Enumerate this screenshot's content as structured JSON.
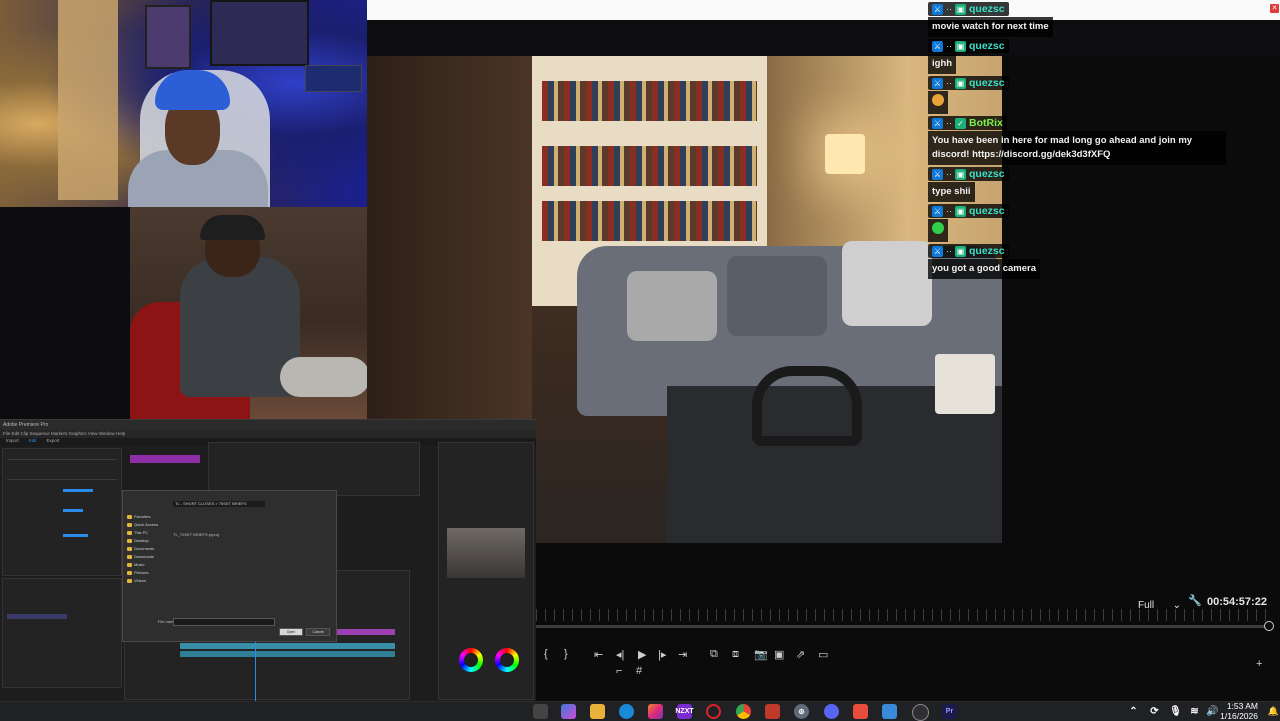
{
  "chat": {
    "messages": [
      {
        "user": "quezsc",
        "color": "#38e0c8",
        "text": "movie watch for next time"
      },
      {
        "user": "quezsc",
        "color": "#38e0c8",
        "text": "ighh"
      },
      {
        "user": "quezsc",
        "color": "#38e0c8",
        "text": "",
        "emote": "emoji-face-icon"
      },
      {
        "user": "BotRix",
        "color": "#7cf04a",
        "text": "You have been in here for mad long go ahead and join my discord! https://discord.gg/dek3d3fXFQ",
        "bot": true
      },
      {
        "user": "quezsc",
        "color": "#38e0c8",
        "text": "type shii"
      },
      {
        "user": "quezsc",
        "color": "#38e0c8",
        "text": "",
        "emote": "green-emote-icon"
      },
      {
        "user": "quezsc",
        "color": "#38e0c8",
        "text": "you got a good camera"
      }
    ]
  },
  "player": {
    "quality": "Full",
    "timecode": "00:54:57:22"
  },
  "taskbar": {
    "time": "1:53 AM",
    "date": "1/16/2026",
    "apps": [
      "explorer-icon",
      "edge-icon",
      "instagram-icon",
      "nzxt-icon",
      "opera-icon",
      "chrome-icon",
      "voicemeeter-icon",
      "settings-icon",
      "discord-icon",
      "app-icon",
      "photos-icon",
      "obs-icon",
      "premiere-icon"
    ],
    "nzxt_label": "NZXT"
  },
  "premiere": {
    "tabs": [
      "Import",
      "Edit",
      "Export"
    ],
    "dialog_path": "TL - SHORT CLOSES > 70SKT BRIEFS",
    "file_row": "TL_70SKT BRIEFS.prproj",
    "file_name_label": "File name:",
    "open_button": "Open",
    "cancel_button": "Cancel",
    "folders": [
      "Favorites",
      "Quick Access",
      "This PC",
      "Desktop",
      "Documents",
      "Downloads",
      "Music",
      "Pictures",
      "Videos"
    ]
  },
  "colors": {
    "accent": "#2d8ceb",
    "username_teal": "#38e0c8",
    "bot_green": "#7cf04a"
  }
}
